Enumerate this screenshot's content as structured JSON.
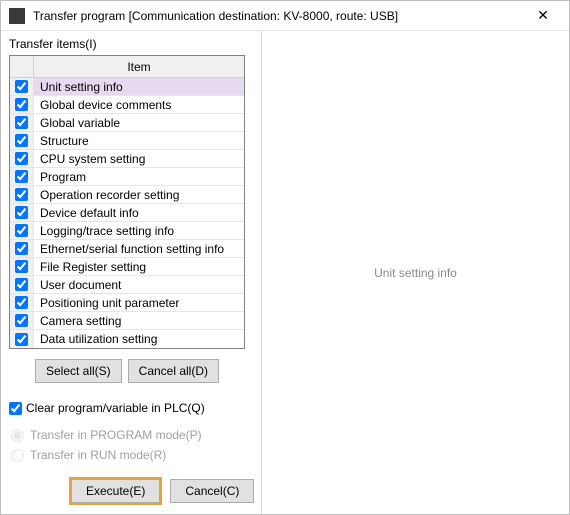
{
  "window": {
    "title": "Transfer program [Communication destination: KV-8000, route: USB]"
  },
  "left": {
    "section_label": "Transfer items(I)",
    "header_item": "Item",
    "rows": [
      {
        "label": "Unit setting info",
        "checked": true,
        "selected": true
      },
      {
        "label": "Global device comments",
        "checked": true,
        "selected": false
      },
      {
        "label": "Global variable",
        "checked": true,
        "selected": false
      },
      {
        "label": "Structure",
        "checked": true,
        "selected": false
      },
      {
        "label": "CPU system setting",
        "checked": true,
        "selected": false
      },
      {
        "label": "Program",
        "checked": true,
        "selected": false
      },
      {
        "label": "Operation recorder setting",
        "checked": true,
        "selected": false
      },
      {
        "label": "Device default info",
        "checked": true,
        "selected": false
      },
      {
        "label": "Logging/trace setting info",
        "checked": true,
        "selected": false
      },
      {
        "label": "Ethernet/serial function setting info",
        "checked": true,
        "selected": false
      },
      {
        "label": "File Register setting",
        "checked": true,
        "selected": false
      },
      {
        "label": "User document",
        "checked": true,
        "selected": false
      },
      {
        "label": "Positioning unit parameter",
        "checked": true,
        "selected": false
      },
      {
        "label": "Camera setting",
        "checked": true,
        "selected": false
      },
      {
        "label": "Data utilization setting",
        "checked": true,
        "selected": false
      }
    ],
    "select_all": "Select all(S)",
    "cancel_all": "Cancel all(D)",
    "clear_label": "Clear program/variable in PLC(Q)",
    "clear_checked": true,
    "radio_program": "Transfer in PROGRAM mode(P)",
    "radio_run": "Transfer in RUN mode(R)",
    "execute": "Execute(E)",
    "cancel": "Cancel(C)"
  },
  "right": {
    "detail": "Unit setting info"
  }
}
